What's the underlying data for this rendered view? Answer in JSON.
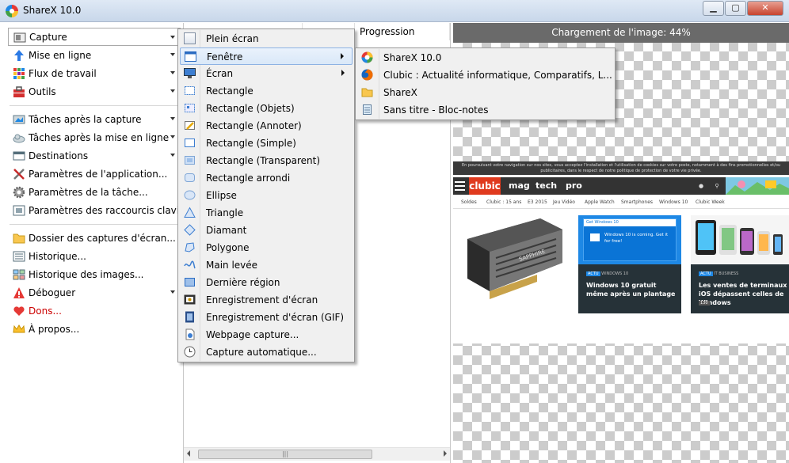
{
  "window": {
    "title": "ShareX 10.0",
    "minimize_icon": "minimize-icon",
    "maximize_icon": "maximize-icon",
    "close_icon": "close-icon"
  },
  "sidebar": {
    "items": [
      {
        "label": "Capture",
        "icon": "capture-icon",
        "has_arrow": true
      },
      {
        "label": "Mise en ligne",
        "icon": "upload-arrow-icon",
        "has_arrow": true
      },
      {
        "label": "Flux de travail",
        "icon": "workflow-grid-icon",
        "has_arrow": true
      },
      {
        "label": "Outils",
        "icon": "toolbox-icon",
        "has_arrow": true
      },
      {
        "label": "Tâches après la capture",
        "icon": "after-capture-icon",
        "has_arrow": true
      },
      {
        "label": "Tâches après la mise en ligne",
        "icon": "cloud-upload-icon",
        "has_arrow": true
      },
      {
        "label": "Destinations",
        "icon": "destinations-icon",
        "has_arrow": true
      },
      {
        "label": "Paramètres de l'application...",
        "icon": "wrench-screwdriver-icon",
        "has_arrow": false
      },
      {
        "label": "Paramètres de la tâche...",
        "icon": "gear-icon",
        "has_arrow": false
      },
      {
        "label": "Paramètres des raccourcis clavier...",
        "icon": "keyboard-shortcut-icon",
        "has_arrow": false
      },
      {
        "label": "Dossier des captures d'écran...",
        "icon": "folder-icon",
        "has_arrow": false
      },
      {
        "label": "Historique...",
        "icon": "history-icon",
        "has_arrow": false
      },
      {
        "label": "Historique des images...",
        "icon": "image-history-icon",
        "has_arrow": false
      },
      {
        "label": "Déboguer",
        "icon": "warning-icon",
        "has_arrow": true
      },
      {
        "label": "Dons...",
        "icon": "heart-icon",
        "has_arrow": false
      },
      {
        "label": "À propos...",
        "icon": "crown-icon",
        "has_arrow": false
      }
    ]
  },
  "task_list": {
    "columns": [
      "Progression"
    ]
  },
  "preview": {
    "loading_text": "Chargement de l'image: 44%",
    "webpage": {
      "cookie_notice": "En poursuivant votre navigation sur nos sites, vous acceptez l'installation et l'utilisation de cookies sur votre poste, notamment à des fins promotionnelles et/ou publicitaires, dans le respect de notre politique de protection de votre vie privée.",
      "logo": "clubic",
      "nav": [
        "mag",
        "tech",
        "pro"
      ],
      "subnav": [
        "Soldes",
        "Clubic : 15 ans",
        "E3 2015",
        "Jeu Vidéo",
        "Apple Watch",
        "Smartphones",
        "Windows 10",
        "Clubic Week"
      ],
      "cards": [
        {
          "tag": "ACTU",
          "category": "WINDOWS 10",
          "headline": "Windows 10 gratuit même après un plantage",
          "banner_title": "Get Windows 10",
          "banner_text": "Windows 10 is coming. Get it for free!"
        },
        {
          "tag": "ACTU",
          "category": "IT BUSINESS",
          "headline": "Les ventes de terminaux iOS dépassent celles de Windows",
          "count": "130"
        }
      ]
    }
  },
  "capture_menu": {
    "items": [
      {
        "label": "Plein écran",
        "icon": "fullscreen-icon",
        "submenu": false
      },
      {
        "label": "Fenêtre",
        "icon": "window-icon",
        "submenu": true,
        "highlighted": true
      },
      {
        "label": "Écran",
        "icon": "monitor-icon",
        "submenu": true
      },
      {
        "label": "Rectangle",
        "icon": "rectangle-icon",
        "submenu": false
      },
      {
        "label": "Rectangle (Objets)",
        "icon": "rectangle-objects-icon",
        "submenu": false
      },
      {
        "label": "Rectangle (Annoter)",
        "icon": "rectangle-annotate-icon",
        "submenu": false
      },
      {
        "label": "Rectangle (Simple)",
        "icon": "rectangle-simple-icon",
        "submenu": false
      },
      {
        "label": "Rectangle (Transparent)",
        "icon": "rectangle-transparent-icon",
        "submenu": false
      },
      {
        "label": "Rectangle arrondi",
        "icon": "rounded-rectangle-icon",
        "submenu": false
      },
      {
        "label": "Ellipse",
        "icon": "ellipse-icon",
        "submenu": false
      },
      {
        "label": "Triangle",
        "icon": "triangle-icon",
        "submenu": false
      },
      {
        "label": "Diamant",
        "icon": "diamond-icon",
        "submenu": false
      },
      {
        "label": "Polygone",
        "icon": "polygon-icon",
        "submenu": false
      },
      {
        "label": "Main levée",
        "icon": "freehand-icon",
        "submenu": false
      },
      {
        "label": "Dernière région",
        "icon": "last-region-icon",
        "submenu": false
      },
      {
        "label": "Enregistrement d'écran",
        "icon": "screen-recording-icon",
        "submenu": false
      },
      {
        "label": "Enregistrement d'écran (GIF)",
        "icon": "gif-recording-icon",
        "submenu": false
      },
      {
        "label": "Webpage capture...",
        "icon": "webpage-capture-icon",
        "submenu": false
      },
      {
        "label": "Capture automatique...",
        "icon": "clock-icon",
        "submenu": false
      }
    ]
  },
  "window_submenu": {
    "items": [
      {
        "label": "ShareX 10.0",
        "icon": "sharex-icon"
      },
      {
        "label": "Clubic : Actualité informatique, Comparatifs, L...",
        "icon": "firefox-icon"
      },
      {
        "label": "ShareX",
        "icon": "folder-icon"
      },
      {
        "label": "Sans titre - Bloc-notes",
        "icon": "notepad-icon"
      }
    ]
  }
}
